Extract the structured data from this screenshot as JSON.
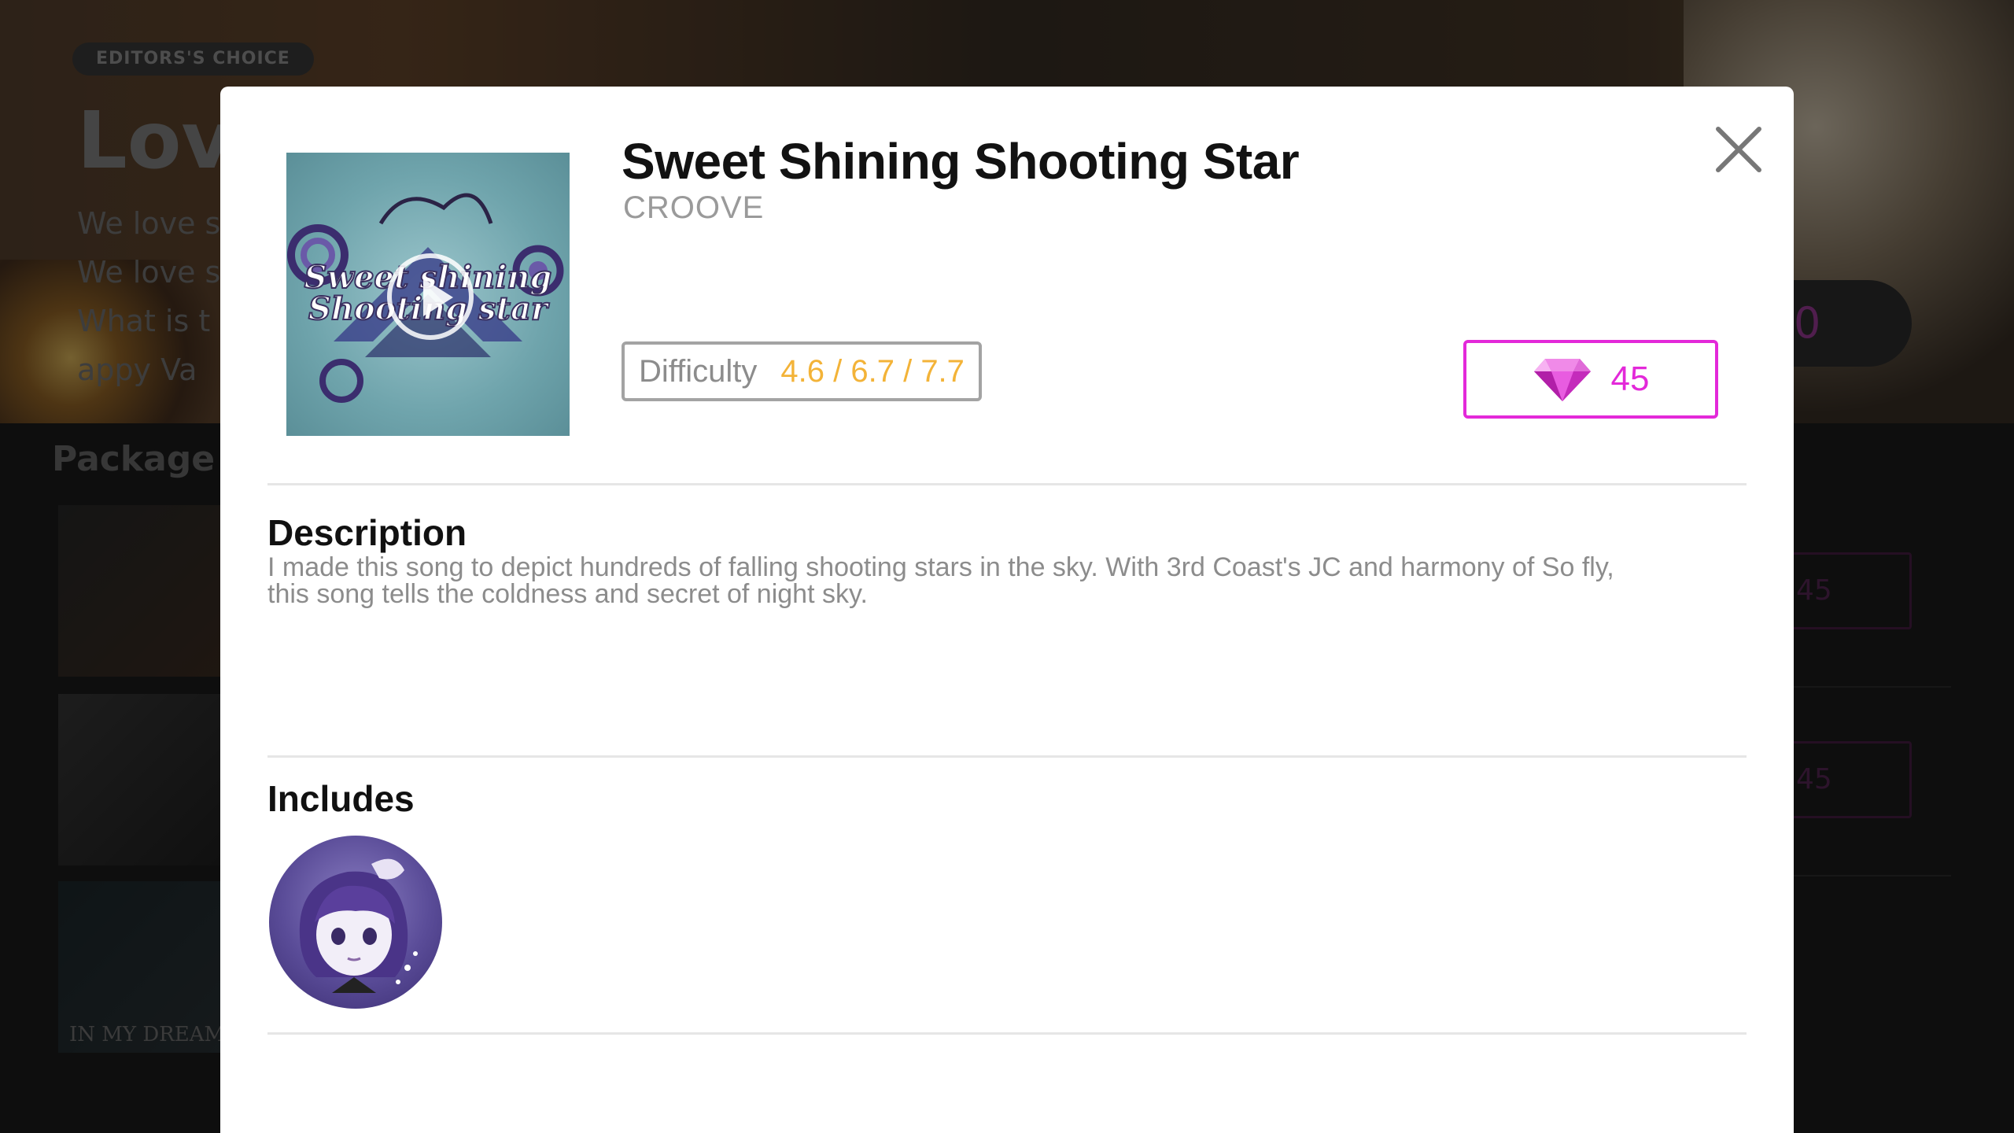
{
  "background": {
    "tag": "EDITORS'S CHOICE",
    "title": "Love",
    "lines": [
      "We love s",
      "We love s",
      "What is t",
      "appy Va"
    ],
    "banner_button": "0",
    "section_title": "Package li",
    "thumb_label": "IN MY DREAM",
    "prices": [
      "45",
      "45"
    ]
  },
  "modal": {
    "song_title": "Sweet Shining Shooting Star",
    "artist": "CROOVE",
    "cover_text_line1": "Sweet shining",
    "cover_text_line2": "Shooting star",
    "difficulty_label": "Difficulty",
    "difficulty_values": "4.6 / 6.7 / 7.7",
    "price": "45",
    "description_heading": "Description",
    "description_line1": "I made this song to depict hundreds of falling shooting stars in the sky. With 3rd Coast's JC and harmony of So fly,",
    "description_line2": "this song tells the coldness and secret of night sky.",
    "includes_heading": "Includes",
    "included_items": [
      {
        "icon": "character-avatar-icon"
      }
    ]
  },
  "colors": {
    "accent_magenta": "#e329d9",
    "difficulty_gold": "#f3b338",
    "modal_background": "#ffffff"
  },
  "icons": {
    "close": "close-icon",
    "play": "play-icon",
    "currency": "diamond-icon"
  }
}
